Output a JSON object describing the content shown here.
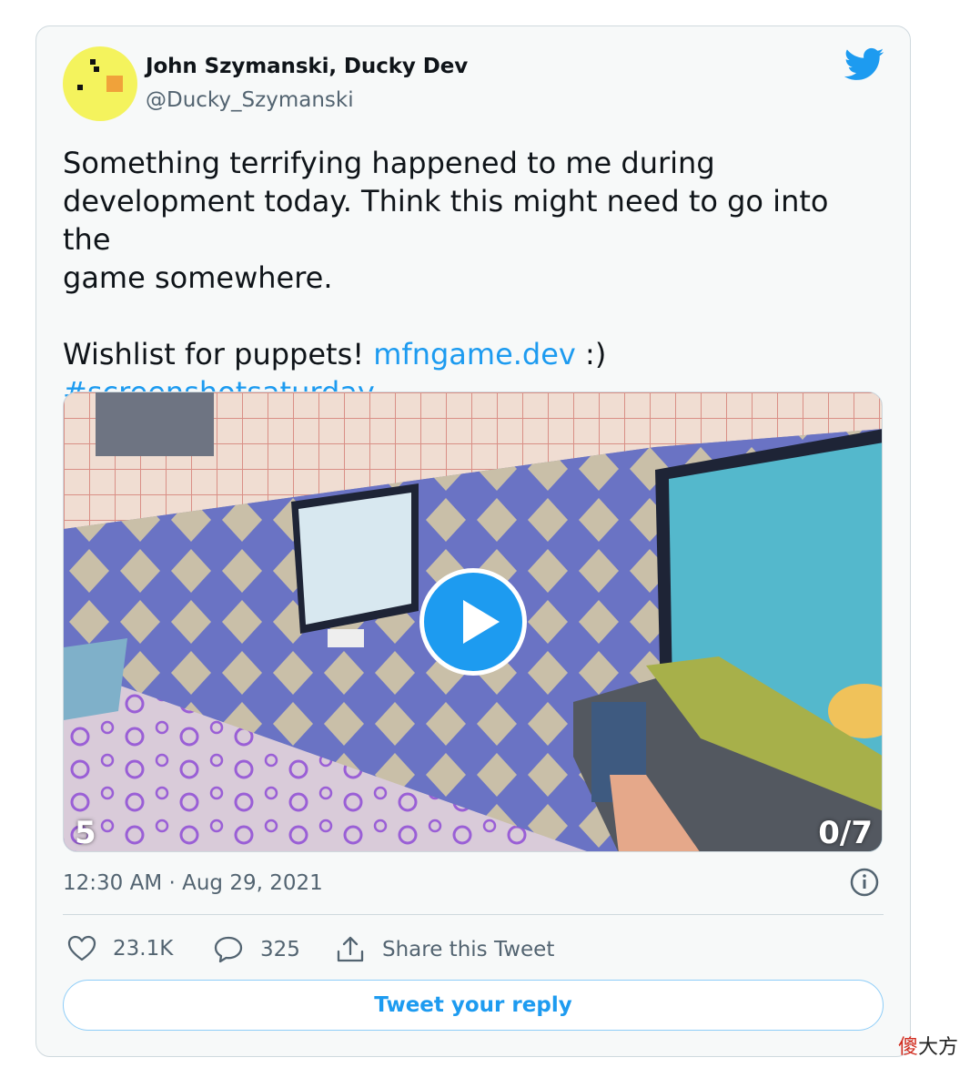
{
  "author": {
    "name": "John Szymanski, Ducky Dev",
    "handle": "@Ducky_Szymanski"
  },
  "tweet": {
    "body": "Something terrifying happened to me during\ndevelopment today. Think this might need to go into the\ngame somewhere.\n\nWishlist for puppets! ",
    "link": "mfngame.dev",
    "after_link": " :)",
    "hashtag": "#screenshotsaturday"
  },
  "media": {
    "overlay_left": "5",
    "overlay_right": "0/7"
  },
  "timestamp": "12:30 AM · Aug 29, 2021",
  "actions": {
    "likes": "23.1K",
    "replies": "325",
    "share_label": "Share this Tweet"
  },
  "reply_button": "Tweet your reply",
  "watermark": {
    "first": "傻",
    "rest": "大方"
  },
  "colors": {
    "accent": "#1d9bf0",
    "muted": "#536471",
    "avatar": "#f4f35d"
  },
  "icons": [
    "twitter-bird-icon",
    "play-icon",
    "info-icon",
    "heart-icon",
    "comment-icon",
    "share-icon"
  ]
}
